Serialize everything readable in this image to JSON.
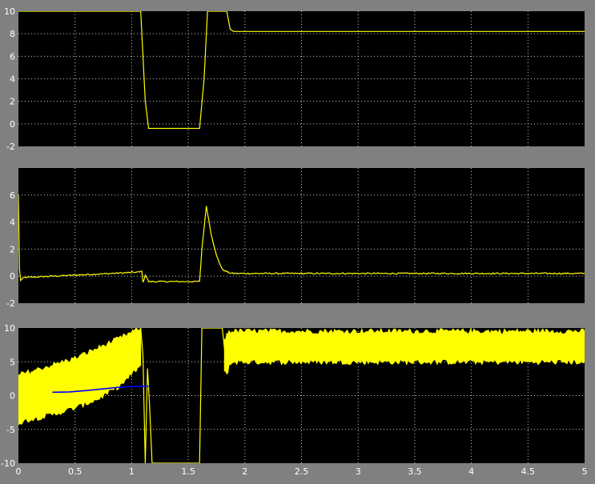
{
  "window": {
    "background": "#808080"
  },
  "colors": {
    "axes_bg": "#000000",
    "grid": "#ffffff",
    "tick_text": "#ffffff",
    "trace_primary": "#ffff00",
    "trace_secondary": "#0000ff"
  },
  "x_ticks": [
    {
      "v": 0,
      "label": "0"
    },
    {
      "v": 0.5,
      "label": "0.5"
    },
    {
      "v": 1,
      "label": "1"
    },
    {
      "v": 1.5,
      "label": "1.5"
    },
    {
      "v": 2,
      "label": "2"
    },
    {
      "v": 2.5,
      "label": "2.5"
    },
    {
      "v": 3,
      "label": "3"
    },
    {
      "v": 3.5,
      "label": "3.5"
    },
    {
      "v": 4,
      "label": "4"
    },
    {
      "v": 4.5,
      "label": "4.5"
    },
    {
      "v": 5,
      "label": "5"
    }
  ],
  "chart_data": [
    {
      "type": "line",
      "title": "",
      "xlabel": "",
      "ylabel": "",
      "xlim": [
        0,
        5
      ],
      "ylim": [
        -2,
        10
      ],
      "grid": true,
      "y_ticks": [
        {
          "v": -2,
          "label": "-2"
        },
        {
          "v": 0,
          "label": "0"
        },
        {
          "v": 2,
          "label": "2"
        },
        {
          "v": 4,
          "label": "4"
        },
        {
          "v": 6,
          "label": "6"
        },
        {
          "v": 8,
          "label": "8"
        },
        {
          "v": 10,
          "label": "10"
        }
      ],
      "series": [
        {
          "color": "#ffff00",
          "noise": 0,
          "x": [
            0,
            1.08,
            1.12,
            1.15,
            1.6,
            1.64,
            1.67,
            1.84,
            1.87,
            1.9,
            5
          ],
          "y": [
            10,
            10,
            2,
            -0.4,
            -0.4,
            4,
            10,
            10,
            8.4,
            8.2,
            8.2
          ]
        }
      ]
    },
    {
      "type": "line",
      "title": "",
      "xlabel": "",
      "ylabel": "",
      "xlim": [
        0,
        5
      ],
      "ylim": [
        -2,
        8
      ],
      "grid": true,
      "y_ticks": [
        {
          "v": -2,
          "label": "-2"
        },
        {
          "v": 0,
          "label": "0"
        },
        {
          "v": 2,
          "label": "2"
        },
        {
          "v": 4,
          "label": "4"
        },
        {
          "v": 6,
          "label": "6"
        }
      ],
      "series": [
        {
          "color": "#ffff00",
          "noise": 0.05,
          "x": [
            0,
            0.01,
            0.02,
            0.05,
            1.07,
            1.09,
            1.1,
            1.12,
            1.15,
            1.6,
            1.62,
            1.66,
            1.7,
            1.75,
            1.8,
            1.86,
            1.9,
            5
          ],
          "y": [
            6,
            0.5,
            -0.3,
            -0.1,
            0.3,
            0.4,
            -0.5,
            0.1,
            -0.4,
            -0.4,
            2,
            5.2,
            3.2,
            1.5,
            0.5,
            0.25,
            0.2,
            0.2
          ]
        }
      ]
    },
    {
      "type": "line",
      "title": "",
      "xlabel": "",
      "ylabel": "",
      "xlim": [
        0,
        5
      ],
      "ylim": [
        -10,
        10
      ],
      "grid": true,
      "y_ticks": [
        {
          "v": -10,
          "label": "-10"
        },
        {
          "v": -5,
          "label": "-5"
        },
        {
          "v": 0,
          "label": "0"
        },
        {
          "v": 5,
          "label": "5"
        },
        {
          "v": 10,
          "label": "10"
        }
      ],
      "series": [
        {
          "color": "#ffff00",
          "band": true,
          "x": [
            0,
            0.1,
            0.3,
            0.5,
            0.7,
            0.9,
            1.08
          ],
          "y_low": [
            -4,
            -3.5,
            -2.8,
            -1.8,
            -0.5,
            1.5,
            4.5
          ],
          "y_high": [
            3,
            3.5,
            4.5,
            5.5,
            7,
            8.5,
            10
          ]
        },
        {
          "color": "#ffff00",
          "noise": 0,
          "x": [
            1.08,
            1.1,
            1.12,
            1.14,
            1.16,
            1.18,
            1.6,
            1.62,
            1.64,
            1.8,
            1.82,
            1.85
          ],
          "y": [
            10,
            6,
            -10,
            4,
            -2,
            -10,
            -10,
            10,
            10,
            10,
            7,
            5
          ]
        },
        {
          "color": "#ffff00",
          "band": true,
          "x": [
            1.82,
            1.84,
            1.86,
            1.9,
            5
          ],
          "y_low": [
            3.5,
            3,
            4.5,
            5,
            5
          ],
          "y_high": [
            8,
            9,
            9.5,
            9.5,
            9.5
          ]
        },
        {
          "color": "#0000ff",
          "noise": 0,
          "x": [
            0.3,
            0.45,
            0.6,
            0.75,
            0.9,
            1.0,
            1.15
          ],
          "y": [
            0.5,
            0.55,
            0.75,
            1.0,
            1.25,
            1.35,
            1.4
          ]
        }
      ]
    }
  ]
}
